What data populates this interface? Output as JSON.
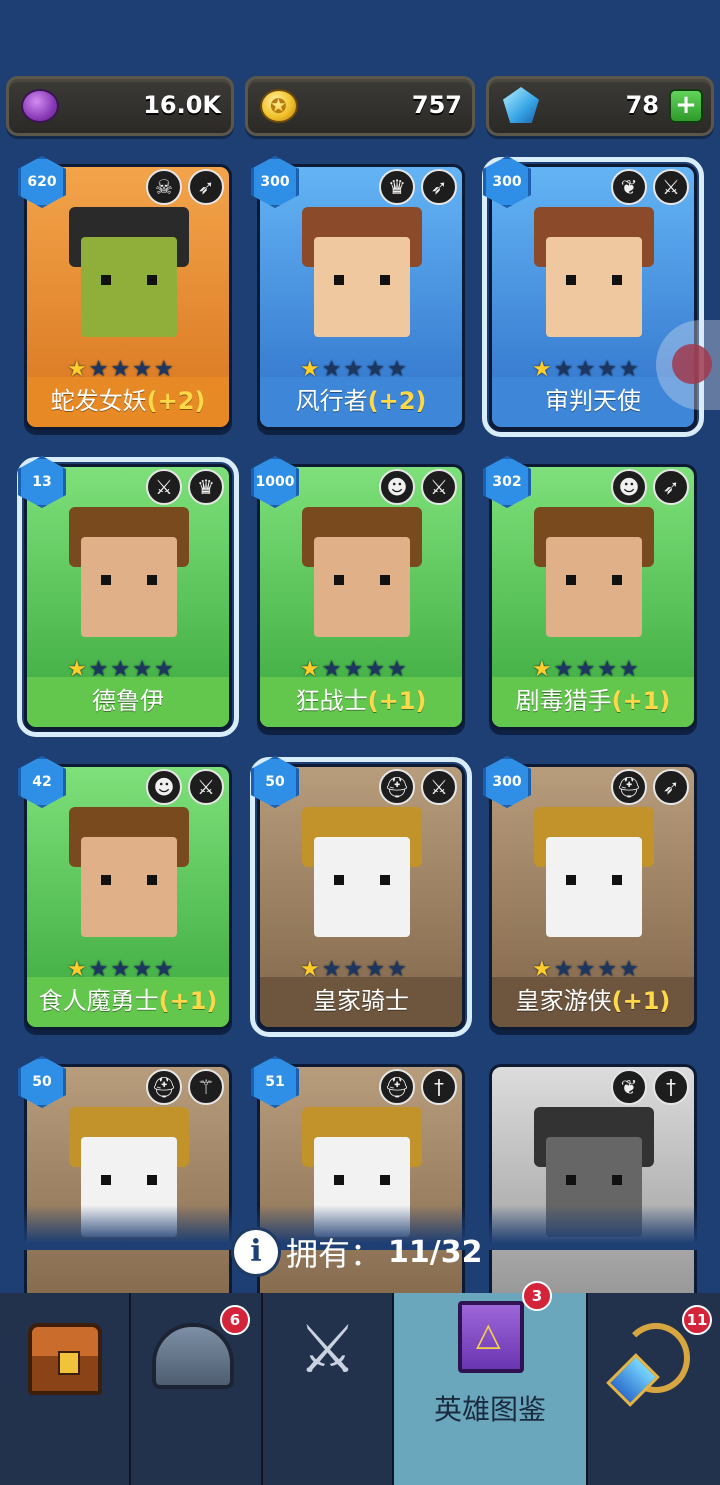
{
  "top_title_fragment": "",
  "currency": {
    "purple": {
      "icon": "purple-token-icon",
      "value": "16.0K"
    },
    "gold": {
      "icon": "gold-coin-icon",
      "value": "757"
    },
    "gem": {
      "icon": "blue-gem-icon",
      "value": "78",
      "add_label": "+"
    }
  },
  "heroes": [
    {
      "name": "蛇发女妖",
      "bonus": "(+2)",
      "level": "620",
      "stars": 1,
      "max_stars": 5,
      "rarity": "orange",
      "race_icon": "demon-skull-icon",
      "weapon_icon": "bow-icon"
    },
    {
      "name": "风行者",
      "bonus": "(+2)",
      "level": "300",
      "stars": 1,
      "max_stars": 5,
      "rarity": "blue",
      "race_icon": "elf-icon",
      "weapon_icon": "bow-icon"
    },
    {
      "name": "审判天使",
      "bonus": "",
      "level": "300",
      "stars": 1,
      "max_stars": 5,
      "rarity": "blue",
      "race_icon": "angel-wings-icon",
      "weapon_icon": "sword-icon"
    },
    {
      "name": "德鲁伊",
      "bonus": "",
      "level": "13",
      "stars": 1,
      "max_stars": 5,
      "rarity": "green",
      "race_icon": "sword-icon",
      "weapon_icon": "elf-icon"
    },
    {
      "name": "狂战士",
      "bonus": "(+1)",
      "level": "1000",
      "stars": 1,
      "max_stars": 5,
      "rarity": "green",
      "race_icon": "orc-icon",
      "weapon_icon": "sword-icon"
    },
    {
      "name": "剧毒猎手",
      "bonus": "(+1)",
      "level": "302",
      "stars": 1,
      "max_stars": 5,
      "rarity": "green",
      "race_icon": "orc-icon",
      "weapon_icon": "bow-icon"
    },
    {
      "name": "食人魔勇士",
      "bonus": "(+1)",
      "level": "42",
      "stars": 1,
      "max_stars": 5,
      "rarity": "green",
      "race_icon": "orc-icon",
      "weapon_icon": "sword-icon"
    },
    {
      "name": "皇家骑士",
      "bonus": "",
      "level": "50",
      "stars": 1,
      "max_stars": 5,
      "rarity": "brown",
      "race_icon": "helmet-icon",
      "weapon_icon": "sword-icon"
    },
    {
      "name": "皇家游侠",
      "bonus": "(+1)",
      "level": "300",
      "stars": 1,
      "max_stars": 5,
      "rarity": "brown",
      "race_icon": "helmet-icon",
      "weapon_icon": "bow-icon"
    },
    {
      "name": "",
      "bonus": "",
      "level": "50",
      "stars": 0,
      "max_stars": 5,
      "rarity": "brown",
      "race_icon": "helmet-icon",
      "weapon_icon": "staff-icon"
    },
    {
      "name": "",
      "bonus": "",
      "level": "51",
      "stars": 0,
      "max_stars": 5,
      "rarity": "brown",
      "race_icon": "helmet-icon",
      "weapon_icon": "dagger-icon"
    },
    {
      "name": "",
      "bonus": "",
      "level": "",
      "stars": 0,
      "max_stars": 5,
      "rarity": "gray",
      "race_icon": "angel-wings-icon",
      "weapon_icon": "dagger-icon"
    }
  ],
  "owned": {
    "label": "拥有：",
    "value": "11/32"
  },
  "nav": [
    {
      "id": "shop",
      "icon": "treasure-chest-icon",
      "badge": ""
    },
    {
      "id": "heroes",
      "icon": "viking-helmet-icon",
      "badge": "6"
    },
    {
      "id": "battle",
      "icon": "crossed-swords-icon",
      "badge": ""
    },
    {
      "id": "codex",
      "icon": "spellbook-icon",
      "badge": "3",
      "label": "英雄图鉴",
      "active": true
    },
    {
      "id": "equipment",
      "icon": "amulet-icon",
      "badge": "11"
    }
  ]
}
